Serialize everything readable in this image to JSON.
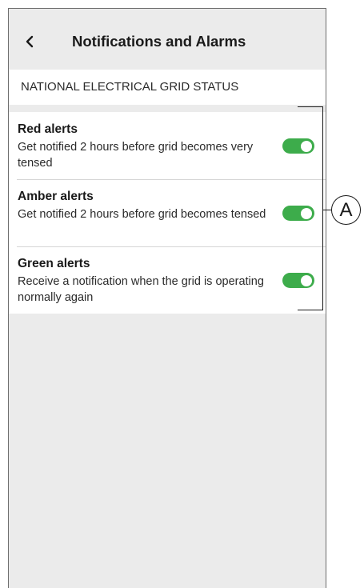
{
  "header": {
    "back_icon": "chevron-left-icon",
    "title": "Notifications and Alarms"
  },
  "section": {
    "title": "NATIONAL ELECTRICAL GRID STATUS"
  },
  "alerts": [
    {
      "title": "Red alerts",
      "description": "Get notified 2 hours before grid becomes very tensed",
      "enabled": true
    },
    {
      "title": "Amber alerts",
      "description": "Get notified 2 hours before grid becomes tensed",
      "enabled": true
    },
    {
      "title": "Green alerts",
      "description": "Receive a notification when the grid is operating normally again",
      "enabled": true
    }
  ],
  "callout": {
    "label": "A"
  },
  "colors": {
    "toggle_on": "#3dac4b",
    "background": "#ebebeb",
    "card": "#ffffff"
  }
}
